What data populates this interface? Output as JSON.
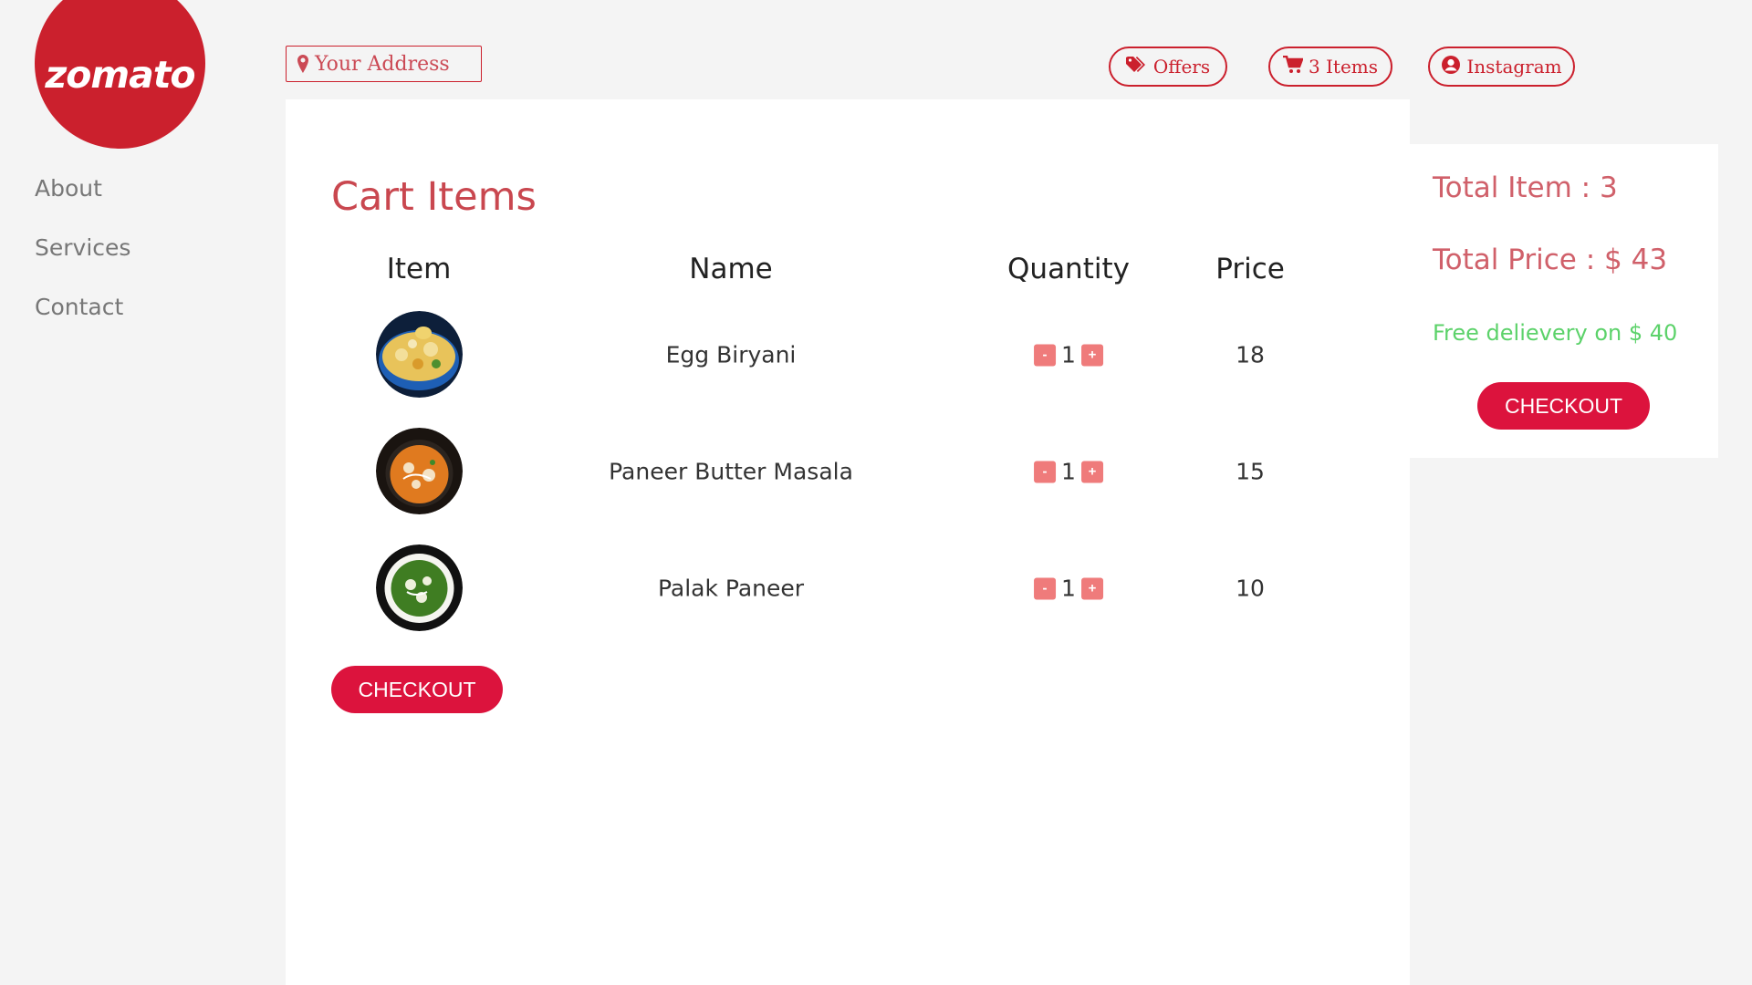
{
  "brand": {
    "logo_text": "zomato",
    "color": "#cb202d"
  },
  "sidenav": {
    "items": [
      "About",
      "Services",
      "Contact"
    ]
  },
  "header": {
    "address_placeholder": "Your Address",
    "offers_label": "Offers",
    "cart_label": "3 Items",
    "instagram_label": "Instagram"
  },
  "cart": {
    "title": "Cart Items",
    "columns": [
      "Item",
      "Name",
      "Quantity",
      "Price"
    ],
    "rows": [
      {
        "name": "Egg Biryani",
        "quantity": "1",
        "price": "18",
        "image": "egg-biryani"
      },
      {
        "name": "Paneer Butter Masala",
        "quantity": "1",
        "price": "15",
        "image": "paneer-butter-masala"
      },
      {
        "name": "Palak Paneer",
        "quantity": "1",
        "price": "10",
        "image": "palak-paneer"
      }
    ],
    "decrement_label": "-",
    "increment_label": "+",
    "checkout_label": "CHECKOUT"
  },
  "summary": {
    "total_items": "Total Item : 3",
    "total_price": "Total Price : $ 43",
    "free_delivery": "Free delievery on $ 40",
    "checkout_label": "CHECKOUT"
  },
  "colors": {
    "accent": "#cb202d",
    "checkout": "#dc133d",
    "title": "#c9474f",
    "free_delivery": "#5cd26a",
    "qty_button": "#ef7b7b"
  }
}
